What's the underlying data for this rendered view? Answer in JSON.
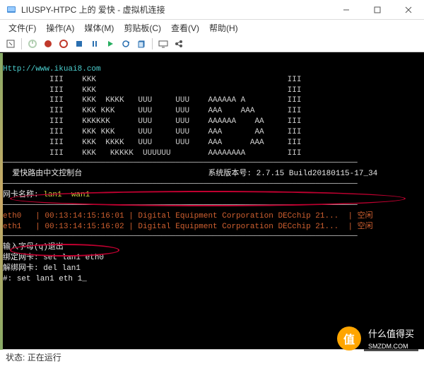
{
  "window": {
    "title": "LIUSPY-HTPC 上的 爱快 - 虚拟机连接"
  },
  "menu": {
    "file": "文件(F)",
    "action": "操作(A)",
    "media": "媒体(M)",
    "clipboard": "剪贴板(C)",
    "view": "查看(V)",
    "help": "帮助(H)"
  },
  "terminal": {
    "url": "Http://www.ikuai8.com",
    "ascii1": "          III    KKK                                         III",
    "ascii2": "          III    KKK                                         III",
    "ascii3": "          III    KKK  KKKK   UUU     UUU    AAAAAA A         III",
    "ascii4": "          III    KKK KKK     UUU     UUU    AAA    AAA       III",
    "ascii5": "          III    KKKKKK      UUU     UUU    AAAAAA    AA     III",
    "ascii6": "          III    KKK KKK     UUU     UUU    AAA       AA     III",
    "ascii7": "          III    KKK  KKKK   UUU     UUU    AAA      AAA     III",
    "ascii8": "          III    KKK   KKKKK  UUUUUU        AAAAAAAA         III",
    "console_title": "  爱快路由中文控制台",
    "version": "系统版本号: 2.7.15 Build20180115-17_34",
    "nic_label": "网卡名称:",
    "nic_values": "lan1  wan1",
    "row0": "eth0   | 00:13:14:15:16:01 | Digital Equipment Corporation DECchip 21...  | 空闲",
    "row1": "eth1   | 00:13:14:15:16:02 | Digital Equipment Corporation DECchip 21...  | 空闲",
    "hint_exit": "输入字母(q)退出",
    "hint_bind": "绑定网卡: set lan1 eth0",
    "hint_unbind": "解绑网卡: del lan1",
    "prompt": "#: set lan1 eth 1_"
  },
  "status": {
    "label": "状态:",
    "value": "正在运行"
  },
  "watermark": {
    "badge": "值",
    "line1": "什么值得买",
    "line2": "SMZDM.COM"
  }
}
